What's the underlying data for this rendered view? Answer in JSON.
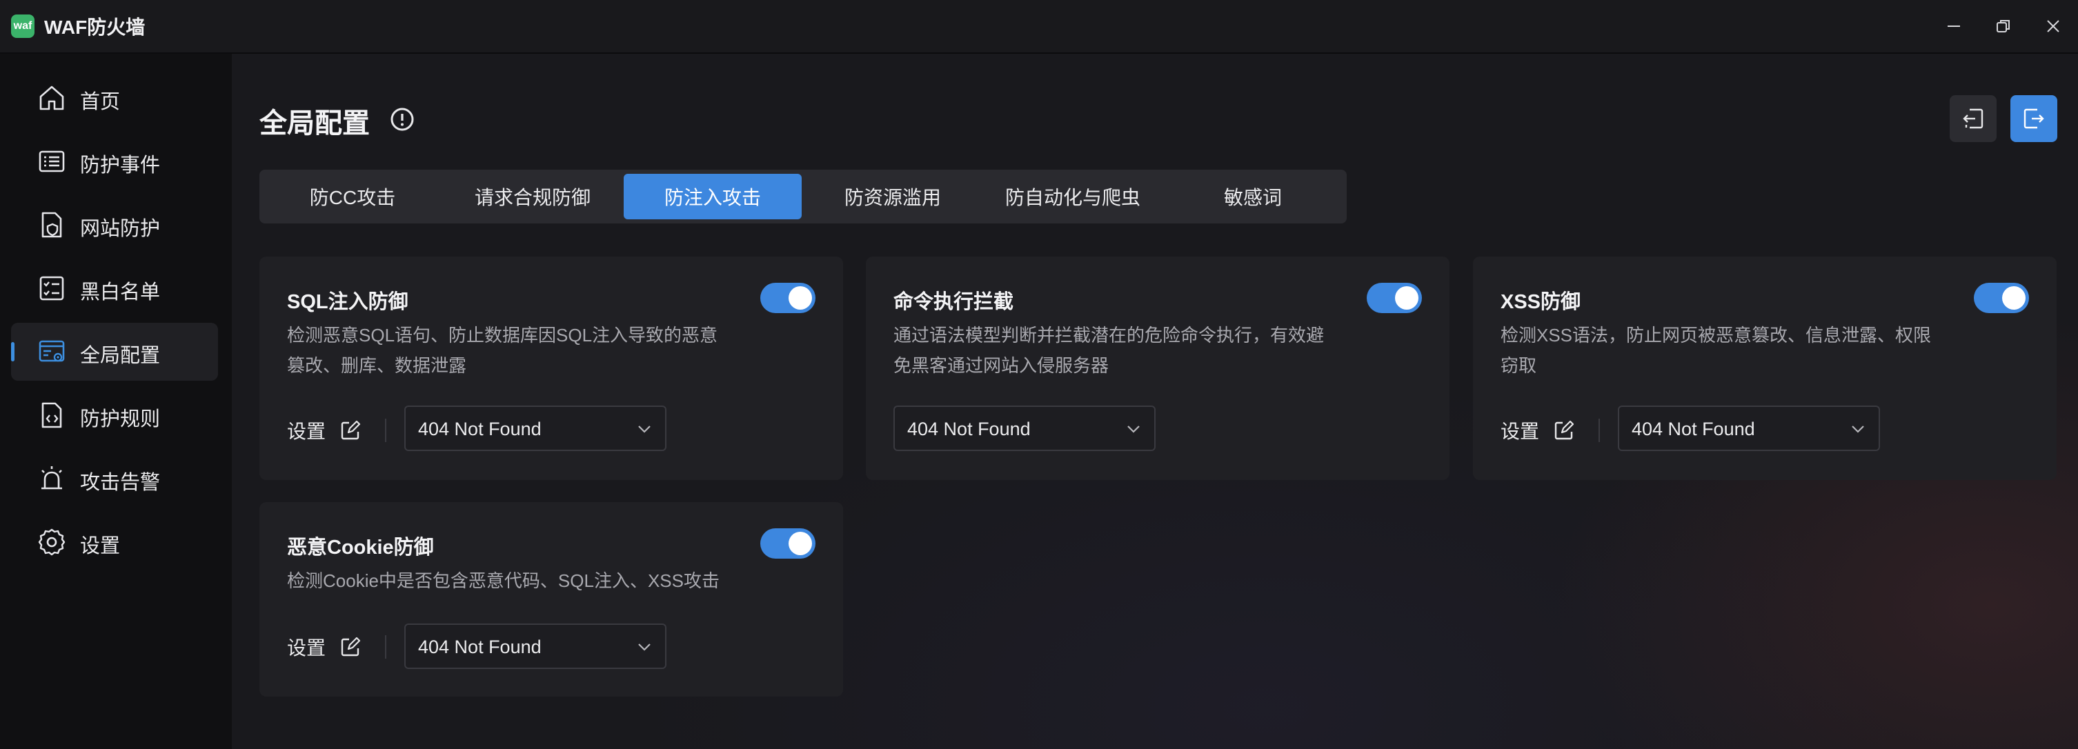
{
  "app": {
    "title": "WAF防火墙",
    "logo_text": "waf"
  },
  "window_controls": [
    "minimize-icon",
    "restore-icon",
    "close-icon"
  ],
  "sidebar": {
    "items": [
      {
        "label": "首页",
        "icon": "home-icon"
      },
      {
        "label": "防护事件",
        "icon": "event-list-icon"
      },
      {
        "label": "网站防护",
        "icon": "site-shield-icon"
      },
      {
        "label": "黑白名单",
        "icon": "checklist-icon"
      },
      {
        "label": "全局配置",
        "icon": "global-config-icon",
        "active": true
      },
      {
        "label": "防护规则",
        "icon": "rule-file-icon"
      },
      {
        "label": "攻击告警",
        "icon": "alarm-icon"
      },
      {
        "label": "设置",
        "icon": "gear-icon"
      }
    ]
  },
  "header": {
    "title": "全局配置",
    "info_icon": "info-icon",
    "import_icon": "import-icon",
    "export_icon": "export-icon"
  },
  "tabs": [
    {
      "label": "防CC攻击"
    },
    {
      "label": "请求合规防御"
    },
    {
      "label": "防注入攻击",
      "active": true
    },
    {
      "label": "防资源滥用"
    },
    {
      "label": "防自动化与爬虫"
    },
    {
      "label": "敏感词"
    }
  ],
  "cards": [
    {
      "title": "SQL注入防御",
      "enabled": true,
      "desc_line1": "检测恶意SQL语句、防止数据库因SQL注入导致的恶意",
      "desc_line2": "篡改、删库、数据泄露",
      "settings_label": "设置",
      "select_value": "404 Not Found"
    },
    {
      "title": "命令执行拦截",
      "enabled": true,
      "desc_line1": "通过语法模型判断并拦截潜在的危险命令执行，有效避",
      "desc_line2": "免黑客通过网站入侵服务器",
      "settings_label": "",
      "select_value": "404 Not Found"
    },
    {
      "title": "XSS防御",
      "enabled": true,
      "desc_line1": "检测XSS语法，防止网页被恶意篡改、信息泄露、权限",
      "desc_line2": "窃取",
      "settings_label": "设置",
      "select_value": "404 Not Found"
    },
    {
      "title": "恶意Cookie防御",
      "enabled": true,
      "desc_line1": "检测Cookie中是否包含恶意代码、SQL注入、XSS攻击",
      "desc_line2": "",
      "settings_label": "设置",
      "select_value": "404 Not Found"
    }
  ],
  "colors": {
    "accent": "#3d87df",
    "card_bg": "#202024",
    "sidebar_bg": "#101012"
  }
}
